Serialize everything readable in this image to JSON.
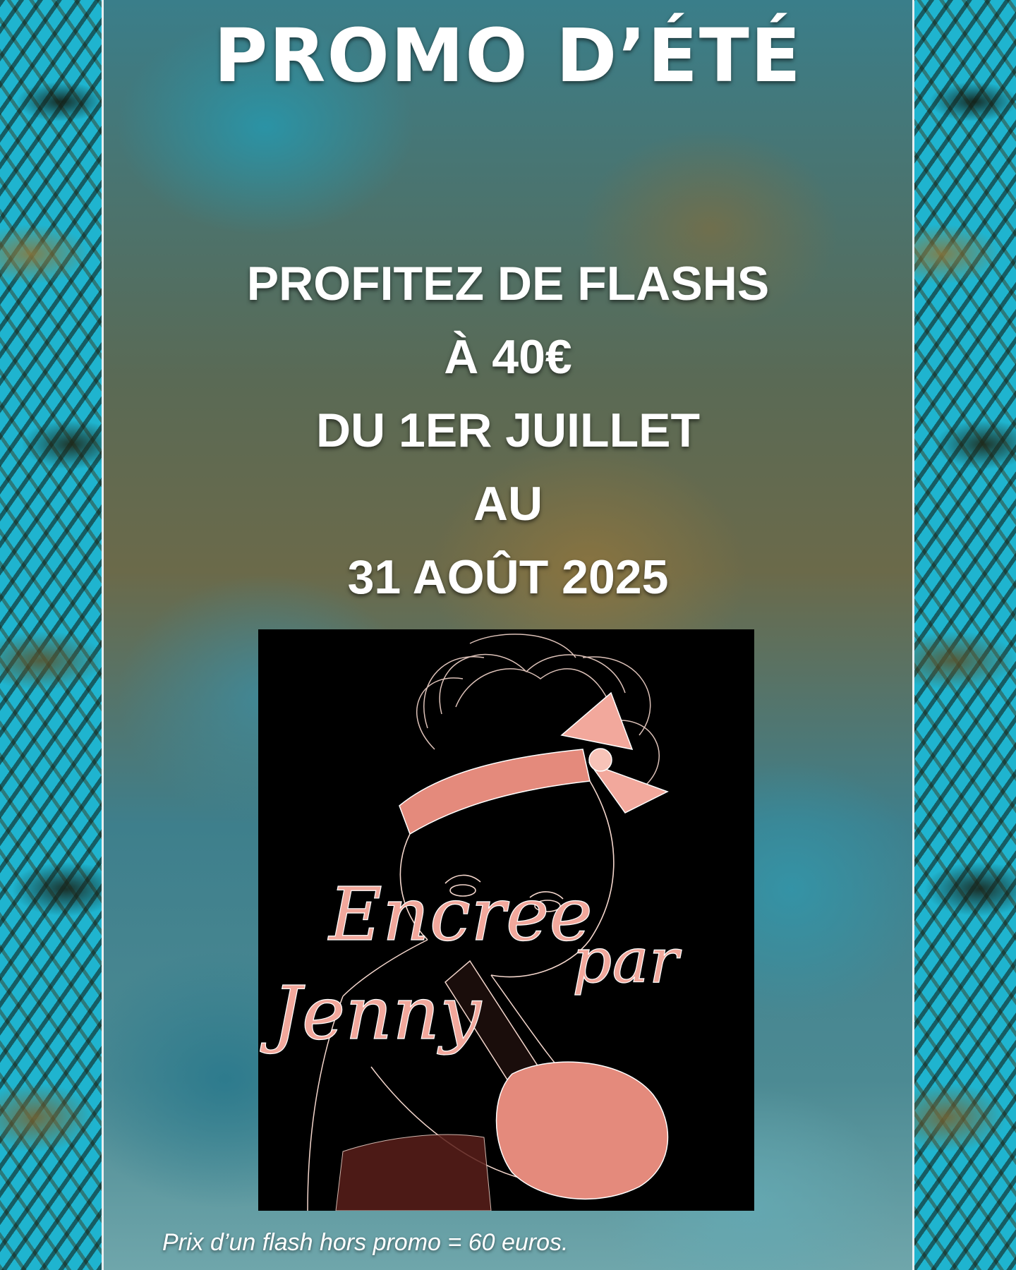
{
  "poster": {
    "title": "PROMO D’ÉTÉ",
    "offer_lines": [
      "PROFITEZ DE FLASHS",
      "À 40€",
      "DU 1ER JUILLET",
      "AU",
      "31 AOÛT 2025"
    ],
    "logo": {
      "text_line1": "Encree",
      "text_word2": "par",
      "text_line2": "Jenny",
      "accent_color": "#f2a89c",
      "background_color": "#000000"
    },
    "footnote": "Prix d’un flash hors promo = 60 euros."
  },
  "colors": {
    "side_sky": "#1fb4cf",
    "title_text": "#ffffff"
  }
}
